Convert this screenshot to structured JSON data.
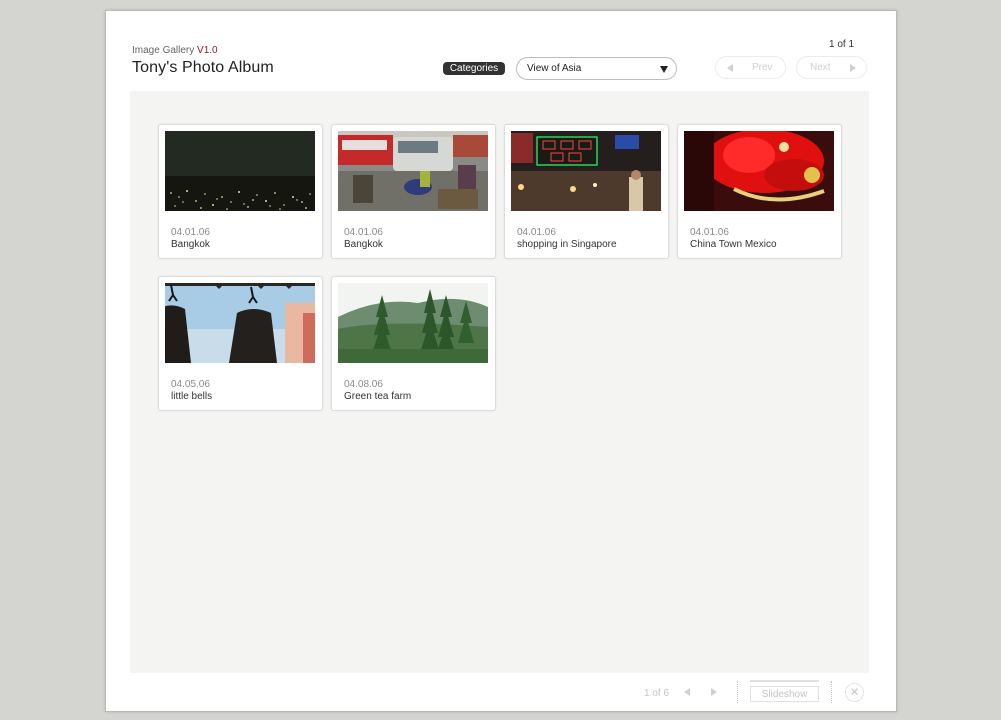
{
  "header": {
    "gallery_label": "Image Gallery",
    "version": "V1.0",
    "album_title": "Tony's Photo Album",
    "page_indicator": "1 of 1",
    "categories_label": "Categories",
    "category_selected": "View of Asia",
    "prev_label": "Prev",
    "next_label": "Next"
  },
  "photos": [
    {
      "date": "04.01.06",
      "caption": "Bangkok"
    },
    {
      "date": "04.01.06",
      "caption": "Bangkok"
    },
    {
      "date": "04.01.06",
      "caption": "shopping in Singapore"
    },
    {
      "date": "04.01.06",
      "caption": "China Town Mexico"
    },
    {
      "date": "04.05.06",
      "caption": "little bells"
    },
    {
      "date": "04.08.06",
      "caption": "Green tea farm"
    }
  ],
  "footer": {
    "page_count": "1 of 6",
    "slideshow_label": "Slideshow"
  },
  "colors": {
    "version_accent": "#8b1a1a",
    "content_bg": "#f4f4f2"
  },
  "icons": {
    "prev": "chevron-left-icon",
    "next": "chevron-right-icon",
    "dropdown": "caret-down-icon",
    "close": "close-icon"
  }
}
